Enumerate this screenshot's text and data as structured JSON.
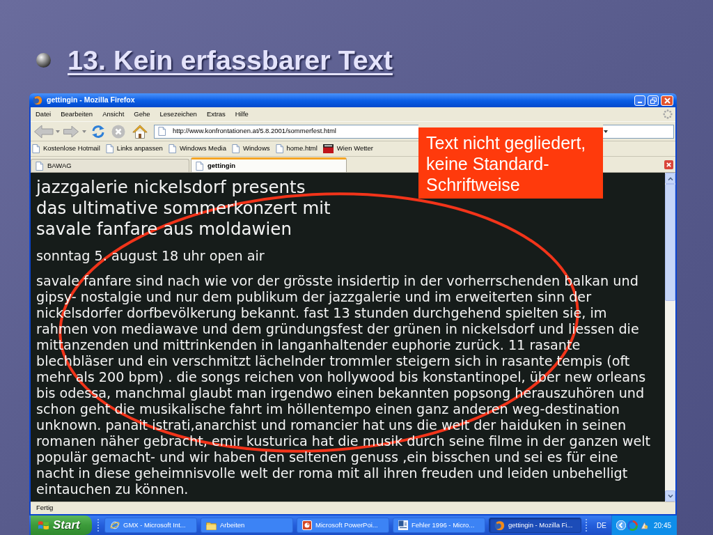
{
  "slide": {
    "title": "13. Kein erfassbarer Text"
  },
  "browser": {
    "title": "gettingin - Mozilla Firefox",
    "menu": [
      "Datei",
      "Bearbeiten",
      "Ansicht",
      "Gehe",
      "Lesezeichen",
      "Extras",
      "Hilfe"
    ],
    "address": "http://www.konfrontationen.at/5.8.2001/sommerfest.html",
    "bookmarks": [
      {
        "label": "Kostenlose Hotmail",
        "kind": "page"
      },
      {
        "label": "Links anpassen",
        "kind": "page"
      },
      {
        "label": "Windows Media",
        "kind": "page"
      },
      {
        "label": "Windows",
        "kind": "page"
      },
      {
        "label": "home.html",
        "kind": "page"
      },
      {
        "label": "Wien Wetter",
        "kind": "banner"
      }
    ],
    "tabs": [
      {
        "label": "BAWAG",
        "selected": false
      },
      {
        "label": "gettingin",
        "selected": true
      }
    ],
    "page": {
      "heading_lines": [
        "jazzgalerie nickelsdorf presents",
        "das ultimative sommerkonzert mit",
        "savale fanfare aus moldawien"
      ],
      "date": "sonntag 5. august 18 uhr open air",
      "paragraph_lines": [
        "savale fanfare sind nach wie vor der grösste insidertip in der vorherrschenden balkan und",
        "gipsy- nostalgie und nur dem publikum der jazzgalerie und im erweiterten sinn der",
        "nickelsdorfer dorfbevölkerung bekannt. fast 13 stunden durchgehend spielten sie, im",
        "rahmen von mediawave und dem gründungsfest der grünen in nickelsdorf und liessen die",
        "mittanzenden und mittrinkenden in langanhaltender euphorie zurück. 11 rasante",
        "blechbläser und ein verschmitzt lächelnder trommler steigern sich in rasante tempis (oft",
        "mehr als 200 bpm) . die songs reichen von hollywood bis konstantinopel, über new orleans",
        "bis odessa, manchmal glaubt man irgendwo einen bekannten popsong herauszuhören und",
        "schon geht die musikalische fahrt im höllentempo einen ganz anderen weg-destination",
        "unknown. panait istrati,anarchist und romancier hat uns die welt der haiduken in seinen",
        "romanen näher gebracht, emir kusturica hat die musik durch seine filme in der ganzen welt",
        "populär gemacht- und wir haben den seltenen genuss ,ein bisschen und sei es für eine",
        "nacht in diese geheimnisvolle welt der roma mit all ihren freuden und leiden unbehelligt",
        "eintauchen zu können."
      ]
    },
    "status": "Fertig"
  },
  "taskbar": {
    "start": "Start",
    "tasks": [
      {
        "label": "GMX - Microsoft Int...",
        "kind": "ie",
        "selected": false
      },
      {
        "label": "Arbeiten",
        "kind": "folder",
        "selected": false
      },
      {
        "label": "Microsoft PowerPoi...",
        "kind": "powerpoint",
        "selected": false
      },
      {
        "label": "Fehler 1996 - Micro...",
        "kind": "word",
        "selected": false
      },
      {
        "label": "gettingin - Mozilla Fi...",
        "kind": "firefox",
        "selected": true
      }
    ],
    "language": "DE",
    "clock": "20:45"
  },
  "callout": {
    "lines": [
      "Text nicht gegliedert,",
      "keine Standard-",
      "Schriftweise"
    ]
  }
}
